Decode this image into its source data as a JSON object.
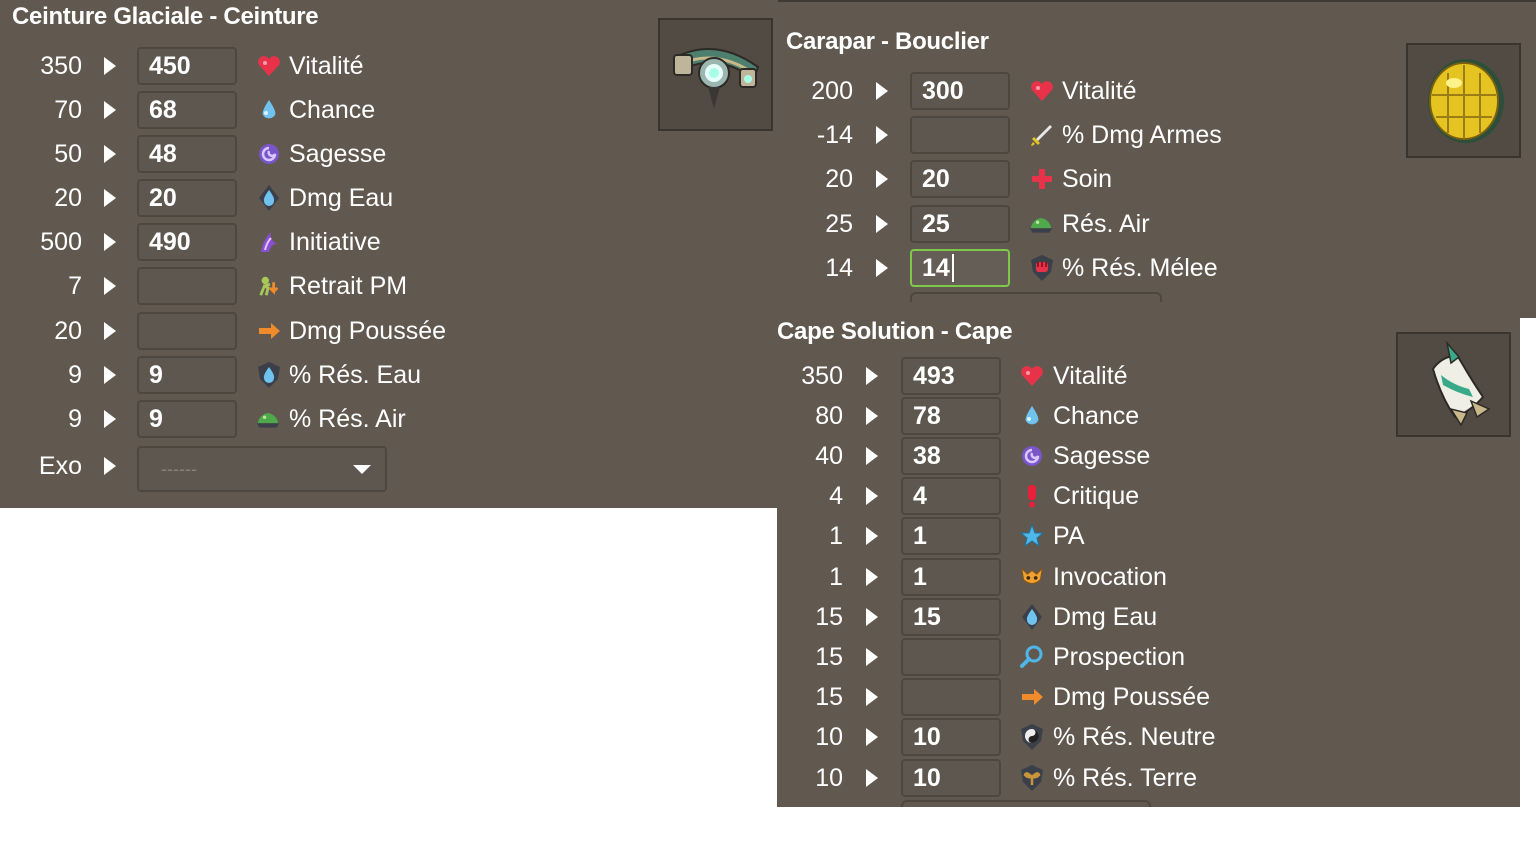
{
  "belt": {
    "title": "Ceinture Glaciale - Ceinture",
    "rows": [
      {
        "base": "350",
        "value": "450",
        "label": "Vitalité",
        "icon": "heart-icon"
      },
      {
        "base": "70",
        "value": "68",
        "label": "Chance",
        "icon": "water-drop-icon"
      },
      {
        "base": "50",
        "value": "48",
        "label": "Sagesse",
        "icon": "wisdom-swirl-icon"
      },
      {
        "base": "20",
        "value": "20",
        "label": "Dmg Eau",
        "icon": "water-damage-icon"
      },
      {
        "base": "500",
        "value": "490",
        "label": "Initiative",
        "icon": "initiative-icon"
      },
      {
        "base": "7",
        "value": "",
        "label": "Retrait PM",
        "icon": "mp-reduction-icon"
      },
      {
        "base": "20",
        "value": "",
        "label": "Dmg Poussée",
        "icon": "pushback-arrow-icon"
      },
      {
        "base": "9",
        "value": "9",
        "label": "% Rés. Eau",
        "icon": "water-resist-icon"
      },
      {
        "base": "9",
        "value": "9",
        "label": "% Rés. Air",
        "icon": "air-resist-icon"
      }
    ],
    "exo": {
      "label": "Exo",
      "placeholder": "------"
    }
  },
  "shield": {
    "title": "Carapar - Bouclier",
    "rows": [
      {
        "base": "200",
        "value": "300",
        "label": "Vitalité",
        "icon": "heart-icon"
      },
      {
        "base": "-14",
        "value": "",
        "label": "% Dmg Armes",
        "icon": "weapon-damage-icon"
      },
      {
        "base": "20",
        "value": "20",
        "label": "Soin",
        "icon": "heal-cross-icon"
      },
      {
        "base": "25",
        "value": "25",
        "label": "Rés. Air",
        "icon": "air-resist-icon"
      },
      {
        "base": "14",
        "value": "14",
        "label": "% Rés. Mélee",
        "icon": "melee-resist-icon"
      }
    ]
  },
  "cape": {
    "title": "Cape Solution - Cape",
    "rows": [
      {
        "base": "350",
        "value": "493",
        "label": "Vitalité",
        "icon": "heart-icon"
      },
      {
        "base": "80",
        "value": "78",
        "label": "Chance",
        "icon": "water-drop-icon"
      },
      {
        "base": "40",
        "value": "38",
        "label": "Sagesse",
        "icon": "wisdom-swirl-icon"
      },
      {
        "base": "4",
        "value": "4",
        "label": "Critique",
        "icon": "critical-icon"
      },
      {
        "base": "1",
        "value": "1",
        "label": "PA",
        "icon": "ap-star-icon"
      },
      {
        "base": "1",
        "value": "1",
        "label": "Invocation",
        "icon": "summon-icon"
      },
      {
        "base": "15",
        "value": "15",
        "label": "Dmg Eau",
        "icon": "water-damage-icon"
      },
      {
        "base": "15",
        "value": "",
        "label": "Prospection",
        "icon": "prospecting-icon"
      },
      {
        "base": "15",
        "value": "",
        "label": "Dmg Poussée",
        "icon": "pushback-arrow-icon"
      },
      {
        "base": "10",
        "value": "10",
        "label": "% Rés. Neutre",
        "icon": "neutral-resist-icon"
      },
      {
        "base": "10",
        "value": "10",
        "label": "% Rés. Terre",
        "icon": "earth-resist-icon"
      }
    ]
  },
  "colors": {
    "panel": "#615950",
    "heart": "#e8324a",
    "water": "#6fc3ee",
    "wisdom": "#7a55c8",
    "air": "#4fa84a",
    "pushback": "#f08a2a",
    "focus": "#7ec94a"
  }
}
